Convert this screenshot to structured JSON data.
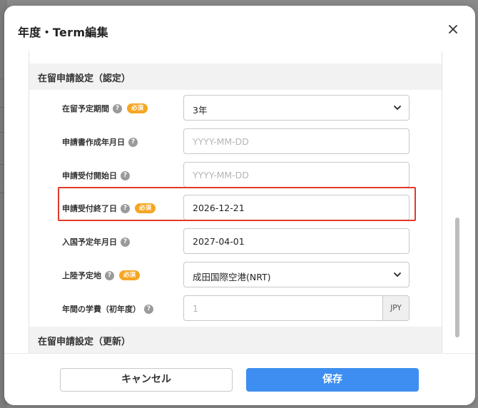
{
  "modal": {
    "title": "年度・Term編集",
    "close_label": "×"
  },
  "sections": {
    "nintei": {
      "title": "在留申請設定（認定）"
    },
    "koshin": {
      "title": "在留申請設定（更新）"
    }
  },
  "fields": {
    "stay_period": {
      "label": "在留予定期間",
      "required_label": "必須",
      "value": "3年"
    },
    "application_created": {
      "label": "申請書作成年月日",
      "placeholder": "YYYY-MM-DD"
    },
    "acceptance_start": {
      "label": "申請受付開始日",
      "placeholder": "YYYY-MM-DD"
    },
    "acceptance_end": {
      "label": "申請受付終了日",
      "required_label": "必須",
      "value": "2026-12-21"
    },
    "entry_date": {
      "label": "入国予定年月日",
      "value": "2027-04-01"
    },
    "landing_place": {
      "label": "上陸予定地",
      "required_label": "必須",
      "value": "成田国際空港(NRT)"
    },
    "annual_tuition": {
      "label": "年間の学費（初年度）",
      "placeholder": "1",
      "currency": "JPY"
    }
  },
  "help_icon_glyph": "?",
  "footer": {
    "cancel_label": "キャンセル",
    "save_label": "保存"
  },
  "colors": {
    "primary": "#3d8ef0",
    "required_badge": "#f5a623",
    "highlight": "#e03a2b"
  }
}
